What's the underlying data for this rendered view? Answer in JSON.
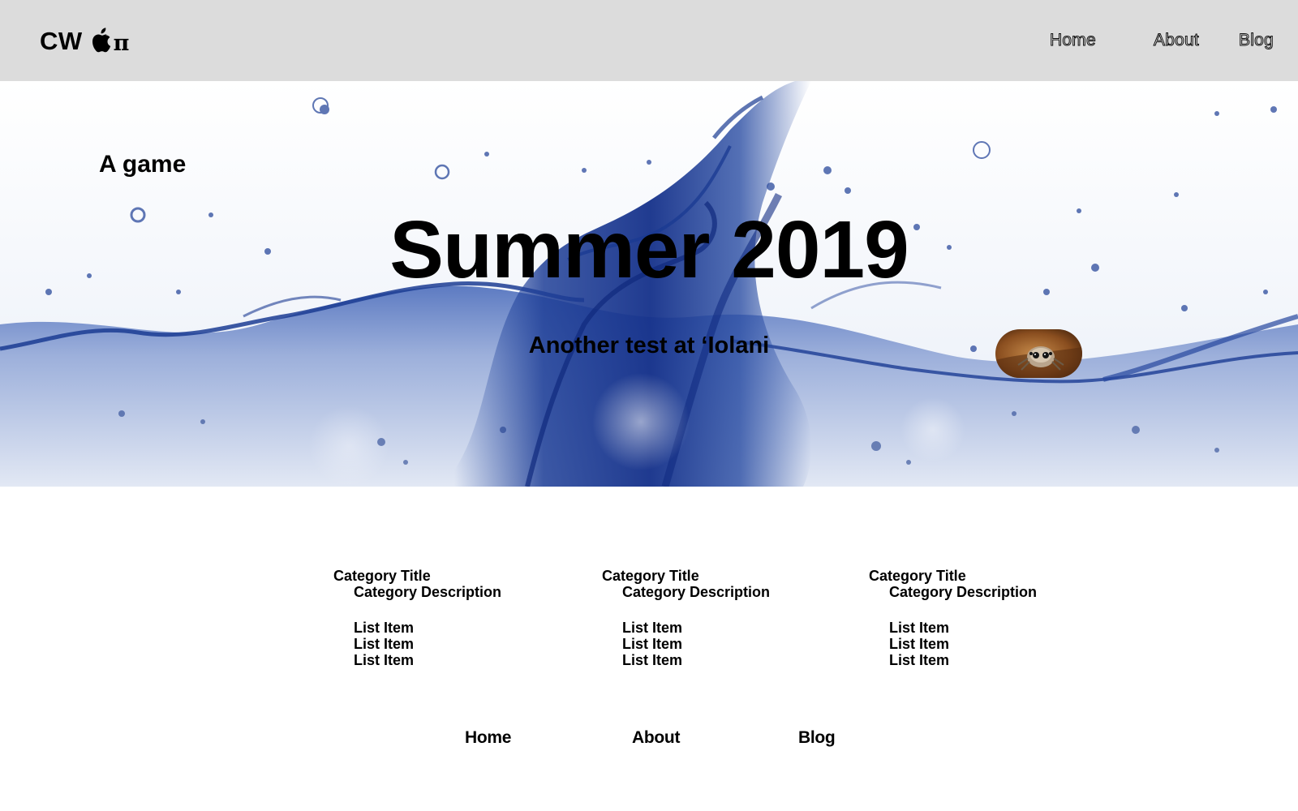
{
  "header": {
    "brand_text": "CW",
    "brand_icon": "apple-logo-icon",
    "brand_suffix": "π",
    "nav": [
      {
        "label": "Home"
      },
      {
        "label": "About"
      },
      {
        "label": "Blog"
      }
    ]
  },
  "hero": {
    "tagline": "A game",
    "title": "Summer 2019",
    "subtitle": "Another test at ‘Iolani",
    "background": "water-splash-image",
    "pill_image": "jumping-spider-photo"
  },
  "categories": [
    {
      "title": "Category Title",
      "description": "Category Description",
      "items": [
        "List Item",
        "List Item",
        "List Item"
      ]
    },
    {
      "title": "Category Title",
      "description": "Category Description",
      "items": [
        "List Item",
        "List Item",
        "List Item"
      ]
    },
    {
      "title": "Category Title",
      "description": "Category Description",
      "items": [
        "List Item",
        "List Item",
        "List Item"
      ]
    }
  ],
  "footer": {
    "nav": [
      {
        "label": "Home"
      },
      {
        "label": "About"
      },
      {
        "label": "Blog"
      }
    ]
  },
  "colors": {
    "topbar_bg": "#dcdcdc",
    "water_deep": "#1d3e94",
    "water_light": "#8ea5d6"
  }
}
